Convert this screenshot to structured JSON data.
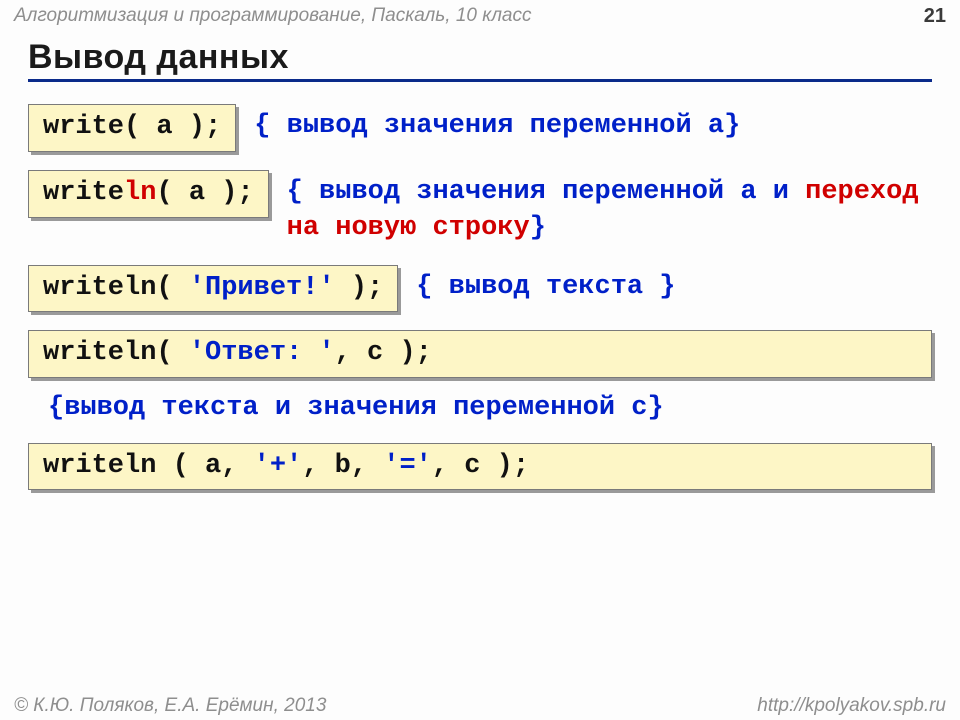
{
  "header": {
    "subject": "Алгоритмизация и программирование, Паскаль, 10 класс",
    "page": "21"
  },
  "title": "Вывод данных",
  "rows": [
    {
      "code_pieces": [
        {
          "t": "write( a );",
          "cls": ""
        }
      ],
      "box_full": false,
      "comment_pieces": [
        {
          "t": "{ вывод значения переменной a}",
          "cls": ""
        }
      ],
      "comment_inline": true
    },
    {
      "code_pieces": [
        {
          "t": "write",
          "cls": ""
        },
        {
          "t": "ln",
          "cls": "ln"
        },
        {
          "t": "( a );",
          "cls": ""
        }
      ],
      "box_full": false,
      "comment_pieces": [
        {
          "t": "{ вывод значения переменной a и ",
          "cls": ""
        },
        {
          "t": "переход на новую строку",
          "cls": "em"
        },
        {
          "t": "}",
          "cls": ""
        }
      ],
      "comment_inline": true
    },
    {
      "code_pieces": [
        {
          "t": "writeln( ",
          "cls": ""
        },
        {
          "t": "'Привет!'",
          "cls": "str"
        },
        {
          "t": " );",
          "cls": ""
        }
      ],
      "box_full": false,
      "comment_pieces": [
        {
          "t": "{ вывод текста }",
          "cls": ""
        }
      ],
      "comment_inline": true
    },
    {
      "code_pieces": [
        {
          "t": "writeln( ",
          "cls": ""
        },
        {
          "t": "'Ответ: '",
          "cls": "str"
        },
        {
          "t": ", c );",
          "cls": ""
        }
      ],
      "box_full": true,
      "comment_pieces": [
        {
          "t": "{вывод текста и значения переменной c}",
          "cls": ""
        }
      ],
      "comment_inline": false
    },
    {
      "code_pieces": [
        {
          "t": "writeln ( a, ",
          "cls": ""
        },
        {
          "t": "'+'",
          "cls": "str"
        },
        {
          "t": ", b, ",
          "cls": ""
        },
        {
          "t": "'='",
          "cls": "str"
        },
        {
          "t": ", c );",
          "cls": ""
        }
      ],
      "box_full": true,
      "comment_pieces": [],
      "comment_inline": false
    }
  ],
  "footer": {
    "copyright": "© К.Ю. Поляков, Е.А. Ерёмин, 2013",
    "url": "http://kpolyakov.spb.ru"
  }
}
